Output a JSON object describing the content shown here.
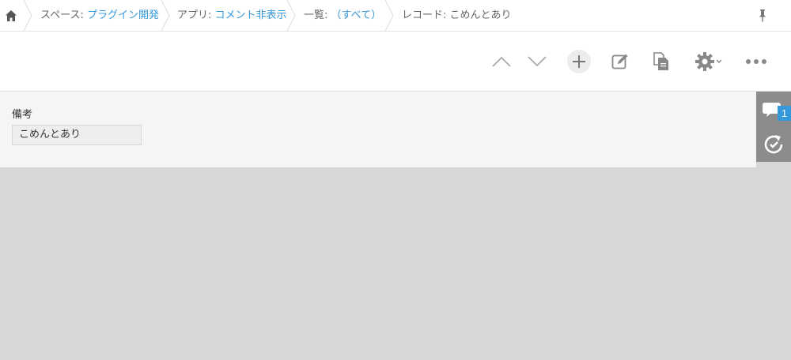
{
  "breadcrumb": {
    "space_prefix": "スペース: ",
    "space_name": "プラグイン開発",
    "app_prefix": "アプリ: ",
    "app_name": "コメント非表示",
    "list_prefix": "一覧: ",
    "list_name": "（すべて）",
    "record_prefix": "レコード: ",
    "record_name": "こめんとあり"
  },
  "toolbar": {
    "icons": [
      "chevron-up-icon",
      "chevron-down-icon",
      "plus-icon",
      "edit-icon",
      "duplicate-icon",
      "gear-icon",
      "more-icon"
    ]
  },
  "record": {
    "field_label": "備考",
    "field_value": "こめんとあり"
  },
  "sidepanel": {
    "comment_count": "1"
  },
  "colors": {
    "link": "#3498db",
    "badge": "#3498db",
    "panel": "#8c8c8c",
    "background": "#d6d7d6"
  }
}
